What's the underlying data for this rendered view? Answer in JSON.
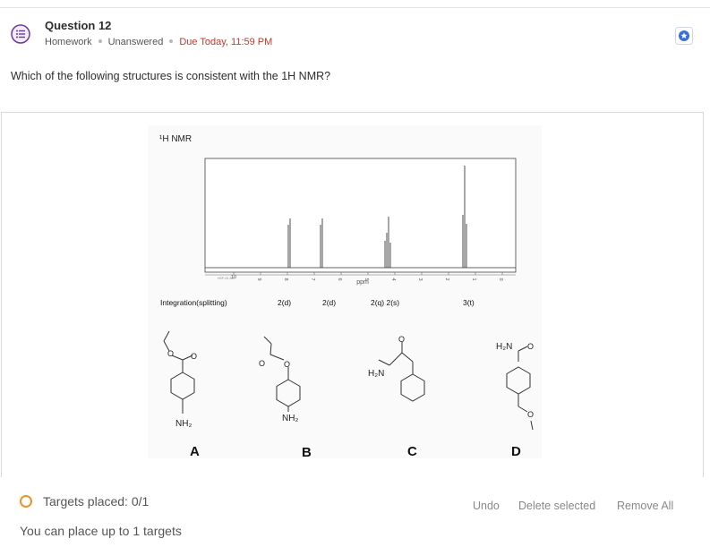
{
  "question": {
    "title": "Question 12",
    "type": "Homework",
    "status": "Unanswered",
    "due": "Due Today, 11:59 PM",
    "prompt": "Which of the following structures is consistent with the 1H NMR?"
  },
  "figure": {
    "heading": "¹H NMR",
    "x_axis_unit": "ppm",
    "watermark": "HSP-00-300",
    "ticks": [
      "10",
      "9",
      "8",
      "7",
      "6",
      "5",
      "4",
      "3",
      "2",
      "1",
      "0"
    ],
    "integration_label": "Integration(splitting)",
    "integrations": [
      "2(d)",
      "2(d)",
      "2(q) 2(s)",
      "3(t)"
    ],
    "options": [
      {
        "letter": "A",
        "group": "NH₂"
      },
      {
        "letter": "B",
        "group": "NH₂"
      },
      {
        "letter": "C",
        "group": "H₂N"
      },
      {
        "letter": "D",
        "group": "H₂N"
      }
    ]
  },
  "targets": {
    "placed": "Targets placed: 0/1",
    "limit": "You can place up to 1 targets"
  },
  "actions": {
    "undo": "Undo",
    "delete_selected": "Delete selected",
    "remove_all": "Remove All"
  },
  "colors": {
    "due": "#c0392b",
    "accent": "#3b6fd4",
    "target_ring": "#f0922b",
    "icon_purple": "#6b3aa0"
  }
}
